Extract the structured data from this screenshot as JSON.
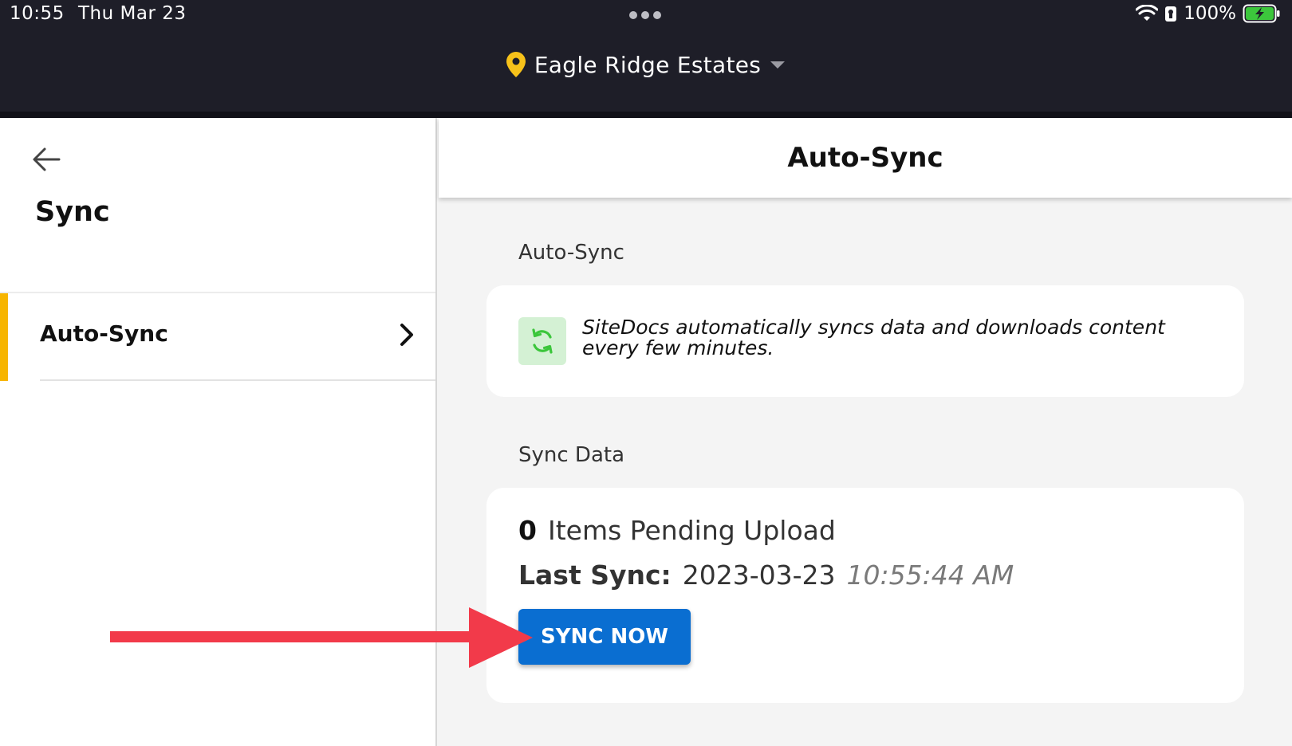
{
  "status_bar": {
    "time": "10:55",
    "date": "Thu Mar 23",
    "battery": "100%"
  },
  "header": {
    "location": "Eagle Ridge Estates"
  },
  "left_pane": {
    "title": "Sync",
    "items": [
      {
        "label": "Auto-Sync"
      }
    ]
  },
  "right_pane": {
    "title": "Auto-Sync",
    "auto_sync_section": {
      "label": "Auto-Sync",
      "description": "SiteDocs automatically syncs data and downloads content every few minutes."
    },
    "sync_data_section": {
      "label": "Sync Data",
      "pending_count": "0",
      "pending_label": "Items Pending Upload",
      "last_sync_label": "Last Sync:",
      "last_sync_date": "2023-03-23",
      "last_sync_time": "10:55:44 AM",
      "button_label": "SYNC NOW"
    }
  },
  "colors": {
    "accent": "#f7b500",
    "primary_button": "#0a6ed1",
    "annotation_arrow": "#f23a4a",
    "sync_icon": "#3cc63c"
  },
  "icons": {
    "back": "arrow-left-icon",
    "location": "map-pin-icon",
    "dropdown": "caret-down-icon",
    "nav_chevron": "chevron-right-icon",
    "sync": "sync-icon",
    "wifi": "wifi-icon",
    "lock": "lock-icon",
    "battery": "battery-charging-icon"
  }
}
